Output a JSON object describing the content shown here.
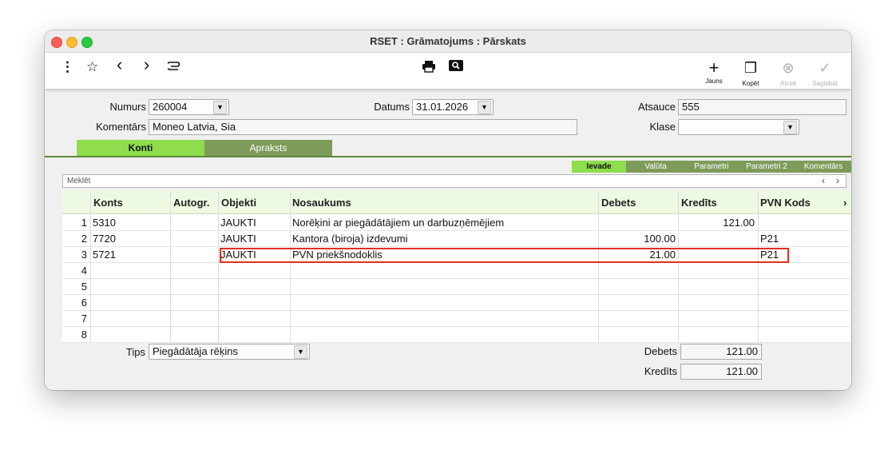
{
  "window": {
    "title": "RSET : Grāmatojums : Pārskats"
  },
  "toolbar": {
    "more_glyph": "⋮",
    "star_glyph": "☆",
    "back_glyph": "‹",
    "forward_glyph": "›",
    "attach_glyph": "⌀",
    "print_glyph": "🖶",
    "preview_glyph": "🔍",
    "new_label": "Jauns",
    "copy_label": "Kopēt",
    "cancel_label": "Atcelt",
    "save_label": "Saglabāt",
    "new_glyph": "+",
    "copy_glyph": "❐",
    "cancel_glyph": "⊗",
    "save_glyph": "✓"
  },
  "form": {
    "numurs_label": "Numurs",
    "numurs_value": "260004",
    "datums_label": "Datums",
    "datums_value": "31.01.2026",
    "atsauce_label": "Atsauce",
    "atsauce_value": "555",
    "komentars_label": "Komentārs",
    "komentars_value": "Moneo Latvia, Sia",
    "klase_label": "Klase",
    "klase_value": ""
  },
  "tabs": [
    "Konti",
    "Apraksts"
  ],
  "subtabs": [
    "Ievade",
    "Valūta",
    "Parametri",
    "Parametri 2",
    "Komentārs"
  ],
  "search": {
    "placeholder": "Meklēt",
    "prev": "‹",
    "next": "›"
  },
  "grid": {
    "columns": [
      "Konts",
      "Autogr.",
      "Objekti",
      "Nosaukums",
      "Debets",
      "Kredīts",
      "PVN Kods"
    ],
    "more_glyph": "›",
    "rows": [
      {
        "n": "1",
        "konts": "5310",
        "autogr": "",
        "objekti": "JAUKTI",
        "nosaukums": "Norēķini ar piegādātājiem un darbuzņēmējiem",
        "debets": "",
        "kredits": "121.00",
        "pvn": ""
      },
      {
        "n": "2",
        "konts": "7720",
        "autogr": "",
        "objekti": "JAUKTI",
        "nosaukums": "Kantora (biroja) izdevumi",
        "debets": "100.00",
        "kredits": "",
        "pvn": "P21"
      },
      {
        "n": "3",
        "konts": "5721",
        "autogr": "",
        "objekti": "JAUKTI",
        "nosaukums": "PVN priekšnodoklis",
        "debets": "21.00",
        "kredits": "",
        "pvn": "P21"
      },
      {
        "n": "4",
        "konts": "",
        "autogr": "",
        "objekti": "",
        "nosaukums": "",
        "debets": "",
        "kredits": "",
        "pvn": ""
      },
      {
        "n": "5",
        "konts": "",
        "autogr": "",
        "objekti": "",
        "nosaukums": "",
        "debets": "",
        "kredits": "",
        "pvn": ""
      },
      {
        "n": "6",
        "konts": "",
        "autogr": "",
        "objekti": "",
        "nosaukums": "",
        "debets": "",
        "kredits": "",
        "pvn": ""
      },
      {
        "n": "7",
        "konts": "",
        "autogr": "",
        "objekti": "",
        "nosaukums": "",
        "debets": "",
        "kredits": "",
        "pvn": ""
      },
      {
        "n": "8",
        "konts": "",
        "autogr": "",
        "objekti": "",
        "nosaukums": "",
        "debets": "",
        "kredits": "",
        "pvn": ""
      }
    ]
  },
  "footer": {
    "tips_label": "Tips",
    "tips_value": "Piegādātāja rēķins",
    "debets_label": "Debets",
    "debets_value": "121.00",
    "kredits_label": "Kredīts",
    "kredits_value": "121.00"
  },
  "colors": {
    "tab_active": "#8fdc4c",
    "tab_inactive": "#7d9c5a",
    "highlight": "#e03020"
  }
}
